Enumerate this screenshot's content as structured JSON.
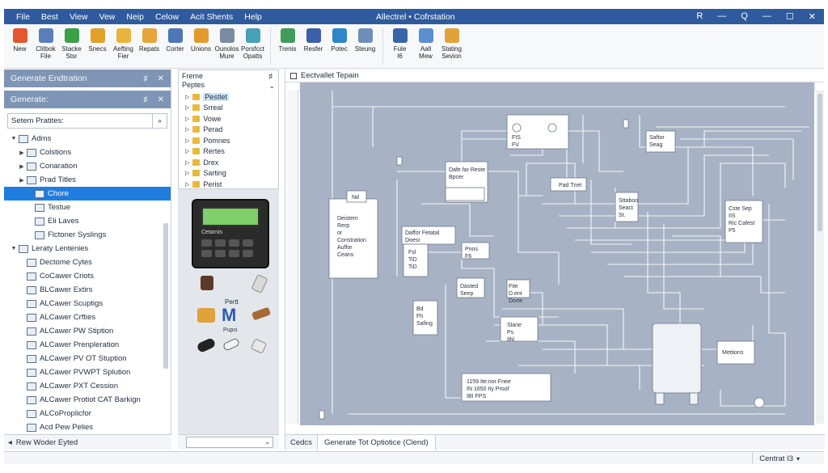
{
  "window": {
    "title": "Allectrel • Cofrstation",
    "menu": [
      "File",
      "Best",
      "View",
      "Vew",
      "Neip",
      "Celow",
      "Acit Shents",
      "Help"
    ],
    "controls": [
      "R",
      "—",
      "Q",
      "—",
      "☐",
      "✕"
    ]
  },
  "ribbon": {
    "group1": [
      {
        "label": "New",
        "icon": "new-icon",
        "color": "#e2572b"
      },
      {
        "label": "Clitbok\nFile",
        "icon": "file-icon",
        "color": "#5a7fb8"
      },
      {
        "label": "Stacke\nStsr",
        "icon": "stack-icon",
        "color": "#3aa04a"
      },
      {
        "label": "Snecs",
        "icon": "bookmark-icon",
        "color": "#e1a126"
      },
      {
        "label": "Aefting\nFier",
        "icon": "edit-icon",
        "color": "#e9b43d"
      },
      {
        "label": "Repats",
        "icon": "report-icon",
        "color": "#e7a43a"
      },
      {
        "label": "Corter",
        "icon": "counter-icon",
        "color": "#4d77b5"
      },
      {
        "label": "Unions",
        "icon": "union-icon",
        "color": "#e29a2d"
      },
      {
        "label": "Ounolos\nMure",
        "icon": "wrench-icon",
        "color": "#7a8aa1"
      },
      {
        "label": "Porsfcct\nOpatts",
        "icon": "pin-icon",
        "color": "#48a0b6"
      }
    ],
    "group2": [
      {
        "label": "Trenis",
        "icon": "globe-icon",
        "color": "#3f9c5a"
      },
      {
        "label": "Resfer",
        "icon": "disc-icon",
        "color": "#3d5fa8"
      },
      {
        "label": "Potec",
        "icon": "drop-icon",
        "color": "#2d86c9"
      },
      {
        "label": "Steung",
        "icon": "doc-icon",
        "color": "#6c8fb9"
      }
    ],
    "group3": [
      {
        "label": "Fule\nI6",
        "icon": "fuel-icon",
        "color": "#3867a8"
      },
      {
        "label": "Aall\nMew",
        "icon": "arrow-icon",
        "color": "#5b8fd0"
      },
      {
        "label": "Stating\nSevion",
        "icon": "home-icon",
        "color": "#e2a23a"
      }
    ]
  },
  "left_panel": {
    "title1": "Generate Endtration",
    "title2": "Generate:",
    "title_controls": [
      "♯",
      "✕"
    ],
    "search_placeholder": "Setem Pratites:",
    "tree": [
      {
        "label": "Adms",
        "indent": 0,
        "twisty": "▼"
      },
      {
        "label": "Colstions",
        "indent": 1,
        "twisty": "▶"
      },
      {
        "label": "Conaration",
        "indent": 1,
        "twisty": "▶"
      },
      {
        "label": "Prad Titles",
        "indent": 1,
        "twisty": "▶"
      },
      {
        "label": "Chore",
        "indent": 2,
        "twisty": "",
        "selected": true
      },
      {
        "label": "Testue",
        "indent": 2,
        "twisty": ""
      },
      {
        "label": "Eli Laves",
        "indent": 2,
        "twisty": ""
      },
      {
        "label": "Flctoner Syslings",
        "indent": 2,
        "twisty": ""
      },
      {
        "label": "Leraty Lentenies",
        "indent": 0,
        "twisty": "▼"
      },
      {
        "label": "Dectome Cytes",
        "indent": 1,
        "twisty": ""
      },
      {
        "label": "CoCawer Criots",
        "indent": 1,
        "twisty": ""
      },
      {
        "label": "BLCawer Extirs",
        "indent": 1,
        "twisty": ""
      },
      {
        "label": "ALCawer Scuptigs",
        "indent": 1,
        "twisty": ""
      },
      {
        "label": "ALCawer Crfties",
        "indent": 1,
        "twisty": ""
      },
      {
        "label": "ALCawer PW Stiption",
        "indent": 1,
        "twisty": ""
      },
      {
        "label": "ALCawer Prenpleration",
        "indent": 1,
        "twisty": ""
      },
      {
        "label": "ALCawer PV OT Stuption",
        "indent": 1,
        "twisty": ""
      },
      {
        "label": "ALCawer PVWPT Splution",
        "indent": 1,
        "twisty": ""
      },
      {
        "label": "ALCawer PXT Cession",
        "indent": 1,
        "twisty": ""
      },
      {
        "label": "ALCawer Protiot CAT Barkign",
        "indent": 1,
        "twisty": ""
      },
      {
        "label": "ALCoProplicfor",
        "indent": 1,
        "twisty": ""
      },
      {
        "label": "Acd Pew Pelies",
        "indent": 1,
        "twisty": ""
      }
    ],
    "status": "Rew Woder Eyted"
  },
  "mid_panel": {
    "header": "Freme\nPeptes",
    "items": [
      "Pestlet",
      "Srreal",
      "Vowe",
      "Perad",
      "Pomnes",
      "Rertes",
      "Drex",
      "Sarting",
      "Perist"
    ],
    "device_screen_text": "Cetarnis",
    "part_label_1": "Pertt",
    "part_label_2": "M",
    "part_label_3": "Pupci"
  },
  "canvas": {
    "tab_title": "Eectvallet Tepain",
    "bottom_tab_1": "Cedcs",
    "bottom_tab_2": "Generate Tot Optiotice (Clend)",
    "labels": {
      "pump": "Nd",
      "generator": "Deistem\nRerp\nor\nConstration\nAuffor\nCeans",
      "dataflow": "Dafe far Reste\nBpcer",
      "psel": "Pad Tnet",
      "ctrl_box": "FIS\nFV",
      "dsaftor": "Daffor Fetatal\nDoesr",
      "t1": "Fsl\nTiD\nTiD",
      "pnos": "Pnos\nF6",
      "dbl": "Dasted\nSeep",
      "bty": "Bd\nFh\nSafing",
      "sfter": "Saftor\nSeag",
      "sc": "Sttaboo\nSeact\nSt.",
      "fte": "Fite\nD.ent\nDorte",
      "csb": "Cste Sep\nIIS\nRic Cafest\nP5",
      "s7": "Slane\nPs\nIlhl",
      "lue": "Lui Stooe\nFSRd",
      "mets": "Mettions",
      "spec": "1159 Ite:nor Fnee\nIN 1650 Ity Proof\nIBI FPS",
      "term": "FIS\nTh"
    }
  },
  "statusbar": {
    "zoom": "Centrat I3"
  }
}
